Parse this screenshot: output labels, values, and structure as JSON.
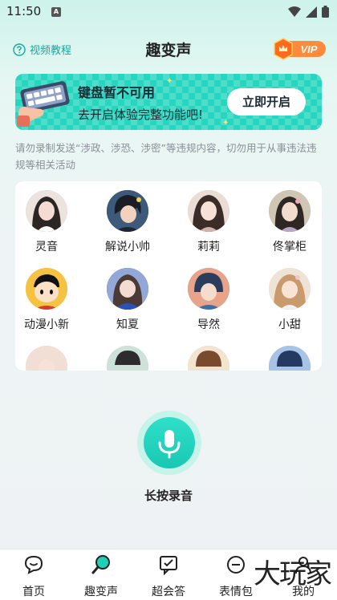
{
  "status_bar": {
    "time": "11:50",
    "app_icon_letter": "A"
  },
  "header": {
    "tutorial_label": "视频教程",
    "title": "趣变声",
    "vip_label": "VIP"
  },
  "banner": {
    "title": "键盘暂不可用",
    "subtitle": "去开启体验完整功能吧!",
    "button_label": "立即开启"
  },
  "notice": "请勿录制发送“涉政、涉恐、涉密”等违规内容，切勿用于从事违法违规等相关活动",
  "voices": [
    {
      "name": "灵音",
      "color": "#e8d6d2"
    },
    {
      "name": "解说小帅",
      "color": "#2c3a4c"
    },
    {
      "name": "莉莉",
      "color": "#d9c2bd"
    },
    {
      "name": "佟掌柜",
      "color": "#c9c0b5"
    },
    {
      "name": "动漫小新",
      "color": "#f5c242"
    },
    {
      "name": "知夏",
      "color": "#3e5fa8"
    },
    {
      "name": "导然",
      "color": "#6bb6d6"
    },
    {
      "name": "小甜",
      "color": "#e9d7c8"
    }
  ],
  "record": {
    "label": "长按录音"
  },
  "tabs": [
    {
      "label": "首页",
      "icon": "chat-bubble-icon"
    },
    {
      "label": "趣变声",
      "icon": "magic-wand-icon"
    },
    {
      "label": "超会答",
      "icon": "answer-bubble-icon"
    },
    {
      "label": "表情包",
      "icon": "smiley-icon"
    },
    {
      "label": "我的",
      "icon": "person-icon"
    }
  ],
  "watermark": "大玩家",
  "colors": {
    "accent": "#1fcfb8",
    "tutorial": "#17a8a0",
    "vip": "#ff7a2e"
  }
}
